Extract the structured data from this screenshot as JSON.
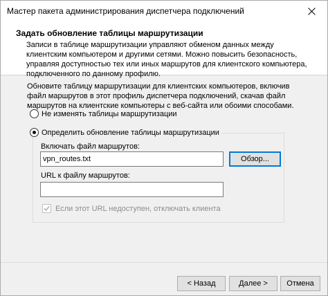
{
  "window": {
    "title": "Мастер пакета администрирования диспетчера подключений",
    "close_icon": "close-icon"
  },
  "header": {
    "title": "Задать обновление таблицы маршрутизации",
    "description": "Записи в таблице маршрутизации управляют обменом данных между клиентским компьютером и другими сетями. Можно повысить безопасность, управляя доступностью тех или иных маршрутов для клиентского компьютера, подключенного по данному профилю."
  },
  "intro": "Обновите таблицу маршрутизации для клиентских компьютеров, включив файл маршрутов в этот профиль диспетчера подключений, скачав файл маршрутов на клиентские компьютеры с веб-сайта или обоими способами.",
  "options": {
    "no_change": {
      "label": "Не изменять таблицы маршрутизации",
      "checked": false
    },
    "define_update": {
      "label": "Определить обновление таблицы маршрутизации",
      "checked": true
    }
  },
  "route_file": {
    "label": "Включать файл маршрутов:",
    "value": "vpn_routes.txt",
    "browse_label": "Обзор..."
  },
  "route_url": {
    "label": "URL к файлу маршрутов:",
    "value": ""
  },
  "disconnect_checkbox": {
    "label": "Если этот URL недоступен, отключать клиента",
    "checked": true,
    "enabled": false
  },
  "buttons": {
    "back": "< Назад",
    "next": "Далее >",
    "cancel": "Отмена"
  }
}
